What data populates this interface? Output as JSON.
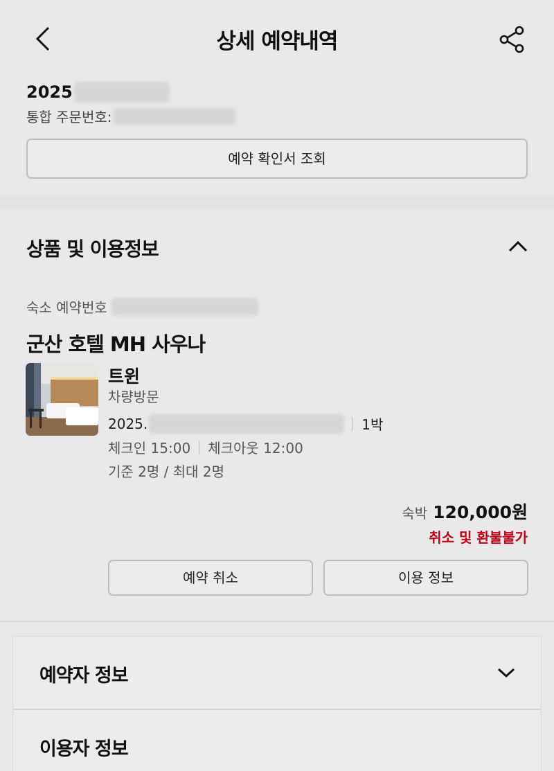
{
  "header": {
    "title": "상세 예약내역",
    "back_icon": "chevron-left-icon",
    "share_icon": "share-icon"
  },
  "order": {
    "date_prefix": "2025",
    "number_label": "통합 주문번호:",
    "confirm_button": "예약 확인서 조회"
  },
  "product_section": {
    "title": "상품 및 이용정보",
    "toggle_icon": "chevron-up-icon",
    "stay_number_label": "숙소 예약번호",
    "hotel_name": "군산 호텔 MH 사우나",
    "room": {
      "type": "트윈",
      "visit_method": "차량방문",
      "date_prefix": "2025.",
      "nights": "1박",
      "checkin": "체크인 15:00",
      "checkout": "체크아웃 12:00",
      "capacity": "기준 2명 / 최대 2명"
    },
    "price_label": "숙박",
    "price_value": "120,000원",
    "refund_policy": "취소 및 환불불가",
    "cancel_button": "예약 취소",
    "info_button": "이용 정보"
  },
  "booker_section": {
    "title": "예약자 정보",
    "toggle_icon": "chevron-down-icon"
  },
  "user_section": {
    "title": "이용자 정보"
  },
  "colors": {
    "background": "#e9e9e9",
    "refund_text": "#c4001a"
  }
}
